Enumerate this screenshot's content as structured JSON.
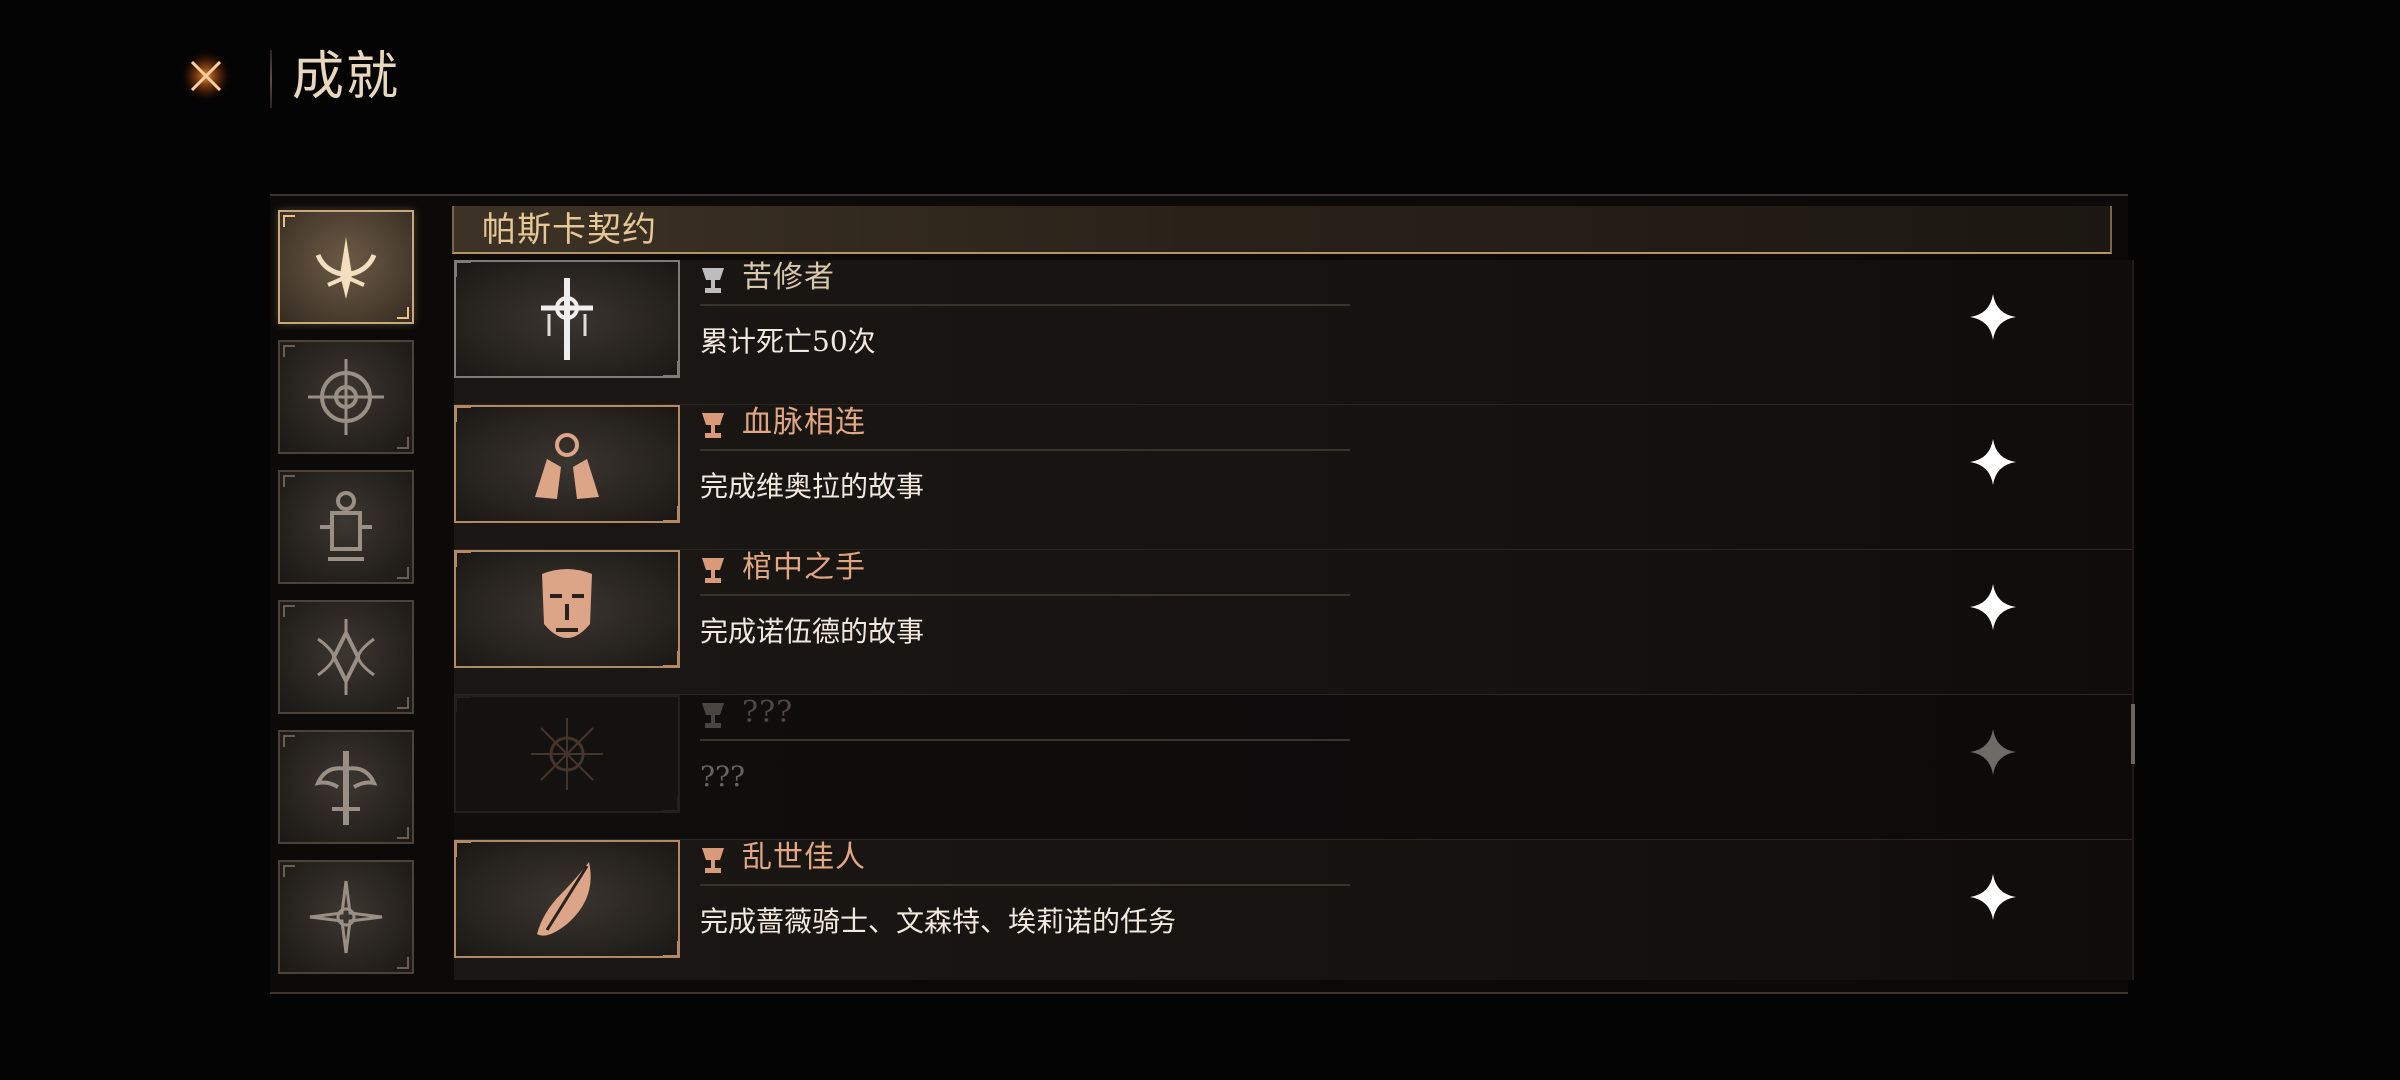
{
  "header": {
    "title": "成就",
    "close_icon": "close-x-icon"
  },
  "colors": {
    "accent_gold": "#c9a778",
    "copper": "#e2a683",
    "close_orange": "#e8741f"
  },
  "sidebar": {
    "categories": [
      {
        "icon": "crescent-flame-icon",
        "active": true
      },
      {
        "icon": "compass-sigil-icon",
        "active": false
      },
      {
        "icon": "lantern-sigil-icon",
        "active": false
      },
      {
        "icon": "thorn-crest-icon",
        "active": false
      },
      {
        "icon": "tree-sword-icon",
        "active": false
      },
      {
        "icon": "radiant-star-icon",
        "active": false
      }
    ]
  },
  "category": {
    "title": "帕斯卡契约"
  },
  "achievements": [
    {
      "name": "苦修者",
      "description": "累计死亡50次",
      "tier": "silver",
      "icon": "cross-dagger-icon",
      "locked": false
    },
    {
      "name": "血脉相连",
      "description": "完成维奥拉的故事",
      "tier": "copper",
      "icon": "twin-hands-icon",
      "locked": false
    },
    {
      "name": "棺中之手",
      "description": "完成诺伍德的故事",
      "tier": "copper",
      "icon": "mask-icon",
      "locked": false
    },
    {
      "name": "???",
      "description": "???",
      "tier": "locked",
      "icon": "sun-sigil-icon",
      "locked": true
    },
    {
      "name": "乱世佳人",
      "description": "完成蔷薇骑士、文森特、埃莉诺的任务",
      "tier": "copper",
      "icon": "feather-leaf-icon",
      "locked": false
    }
  ]
}
